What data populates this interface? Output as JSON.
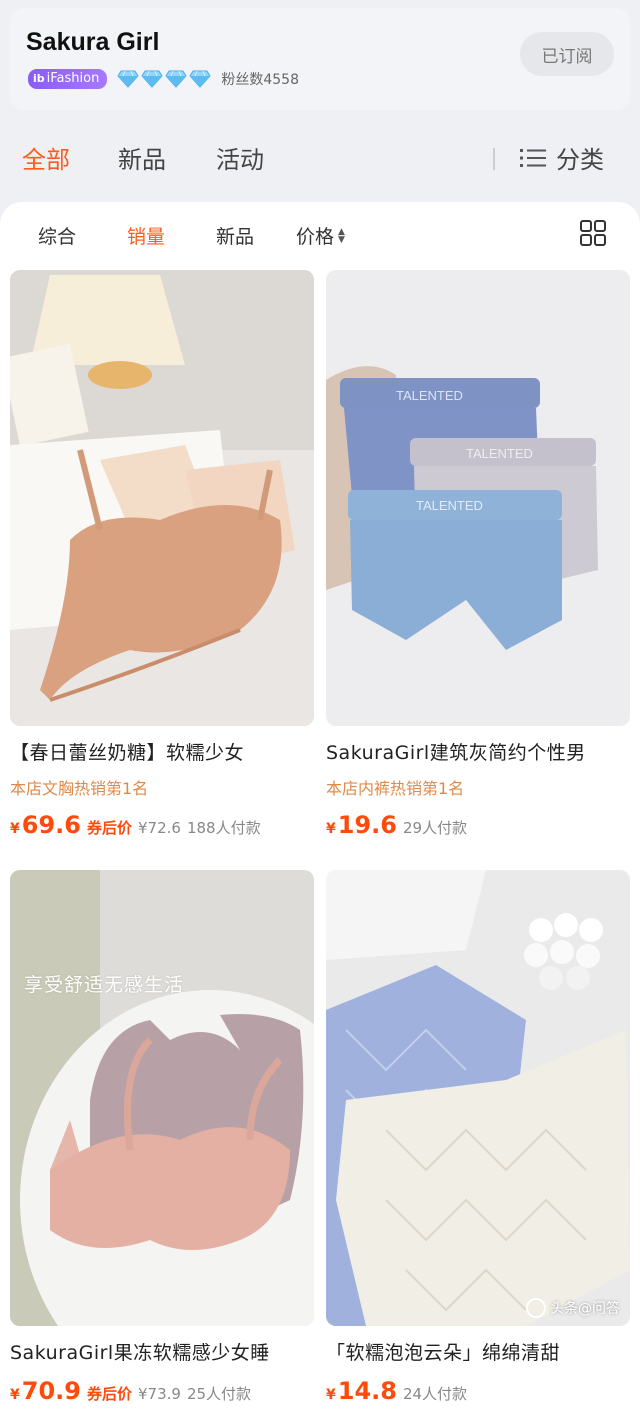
{
  "shop": {
    "name": "Sakura Girl",
    "platform_badge": "iFashion",
    "platform_badge_icon": "ib",
    "diamond_count": 4,
    "fans_label": "粉丝数4558",
    "subscribe_button": "已订阅"
  },
  "nav": {
    "tabs": [
      {
        "label": "全部",
        "active": true
      },
      {
        "label": "新品",
        "active": false
      },
      {
        "label": "活动",
        "active": false
      }
    ],
    "category_label": "分类"
  },
  "sort": {
    "items": [
      {
        "label": "综合",
        "active": false
      },
      {
        "label": "销量",
        "active": true
      },
      {
        "label": "新品",
        "active": false
      },
      {
        "label": "价格",
        "active": false
      }
    ]
  },
  "products": [
    {
      "title": "【春日蕾丝奶糖】软糯少女",
      "rank": "本店文胸热销第1名",
      "currency": "¥",
      "price": "69.6",
      "coupon_label": "券后价",
      "original_price": "¥72.6",
      "sales": "188人付款"
    },
    {
      "title": "SakuraGirl建筑灰简约个性男",
      "rank": "本店内裤热销第1名",
      "currency": "¥",
      "price": "19.6",
      "coupon_label": "",
      "original_price": "",
      "sales": "29人付款",
      "image_text": "TALENTED"
    },
    {
      "title": "SakuraGirl果冻软糯感少女睡",
      "rank": "",
      "currency": "¥",
      "price": "70.9",
      "coupon_label": "券后价",
      "original_price": "¥73.9",
      "sales": "25人付款",
      "image_caption": "享受舒适无感生活"
    },
    {
      "title": "「软糯泡泡云朵」绵绵清甜",
      "rank": "",
      "currency": "¥",
      "price": "14.8",
      "coupon_label": "",
      "original_price": "",
      "sales": "24人付款"
    }
  ],
  "watermark": "头条@问答",
  "colors": {
    "accent": "#ff5a1f",
    "price": "#ff4b0a",
    "rank": "#e08a4a",
    "badge": "#8b5cf6"
  }
}
